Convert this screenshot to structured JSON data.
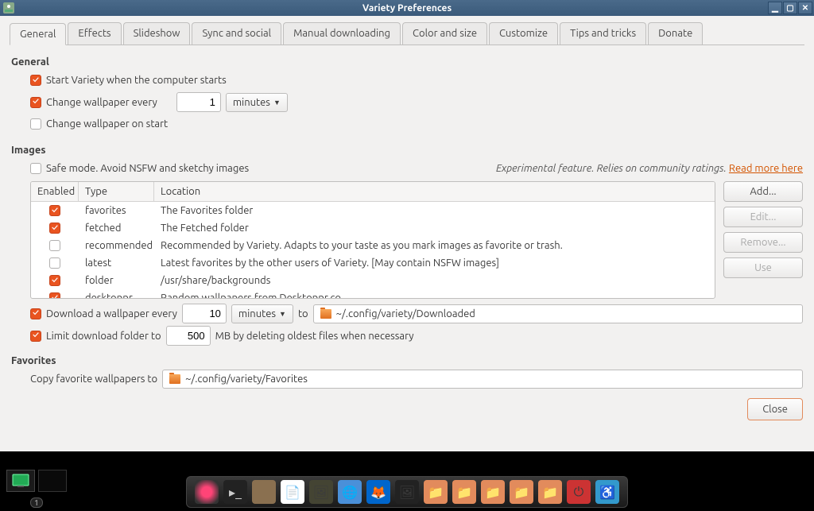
{
  "window": {
    "title": "Variety Preferences"
  },
  "tabs": [
    "General",
    "Effects",
    "Slideshow",
    "Sync and social",
    "Manual downloading",
    "Color and size",
    "Customize",
    "Tips and tricks",
    "Donate"
  ],
  "general": {
    "heading": "General",
    "start_label": "Start Variety when the computer starts",
    "change_label": "Change wallpaper every",
    "change_interval": "1",
    "change_unit": "minutes",
    "onstart_label": "Change wallpaper on start"
  },
  "images": {
    "heading": "Images",
    "safe_label": "Safe mode. Avoid NSFW and sketchy images",
    "experimental": "Experimental feature. Relies on community ratings.",
    "readmore": "Read more here",
    "cols": {
      "enabled": "Enabled",
      "type": "Type",
      "location": "Location"
    },
    "rows": [
      {
        "on": true,
        "type": "favorites",
        "loc": "The Favorites folder"
      },
      {
        "on": true,
        "type": "fetched",
        "loc": "The Fetched folder"
      },
      {
        "on": false,
        "type": "recommended",
        "loc": "Recommended by Variety. Adapts to your taste as you mark images as favorite or trash."
      },
      {
        "on": false,
        "type": "latest",
        "loc": "Latest favorites by the other users of Variety. [May contain NSFW images]"
      },
      {
        "on": true,
        "type": "folder",
        "loc": "/usr/share/backgrounds"
      },
      {
        "on": true,
        "type": "desktoppr",
        "loc": "Random wallpapers from Desktoppr.co"
      }
    ],
    "buttons": {
      "add": "Add...",
      "edit": "Edit...",
      "remove": "Remove...",
      "use": "Use"
    },
    "dl_label": "Download a wallpaper every",
    "dl_interval": "10",
    "dl_unit": "minutes",
    "to": "to",
    "dl_path": "~/.config/variety/Downloaded",
    "limit_label": "Limit download folder to",
    "limit_mb": "500",
    "limit_suffix": "MB by deleting oldest files when necessary"
  },
  "favorites": {
    "heading": "Favorites",
    "copy_label": "Copy favorite wallpapers to",
    "path": "~/.config/variety/Favorites"
  },
  "close": "Close",
  "workspace_num": "1"
}
